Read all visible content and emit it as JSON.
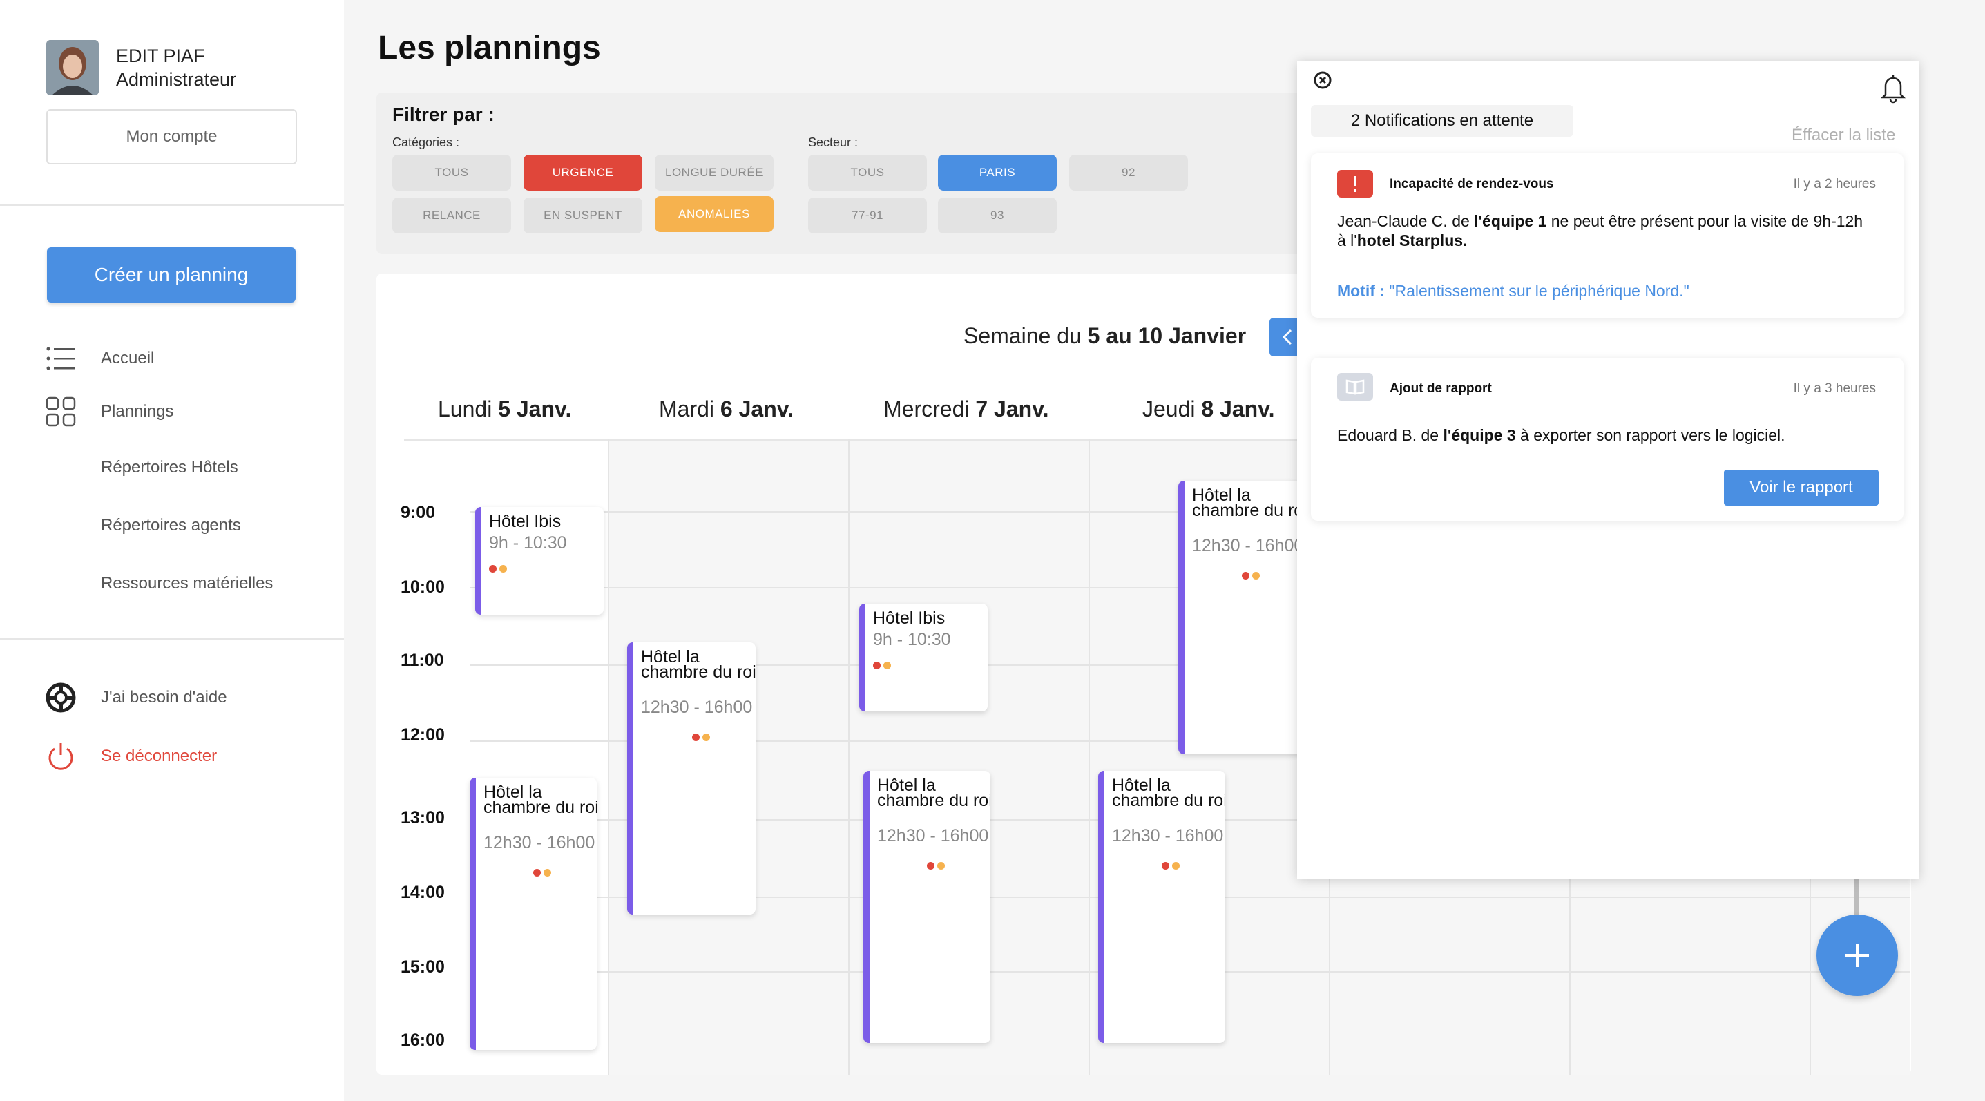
{
  "user": {
    "name": "EDIT PIAF",
    "role": "Administrateur",
    "account_label": "Mon compte"
  },
  "sidebar": {
    "create_label": "Créer un planning",
    "items": [
      {
        "label": "Accueil",
        "icon": "list-icon"
      },
      {
        "label": "Plannings",
        "icon": "grid-icon"
      },
      {
        "label": "Répertoires Hôtels"
      },
      {
        "label": "Répertoires agents"
      },
      {
        "label": "Ressources matérielles"
      }
    ],
    "help_label": "J'ai besoin d'aide",
    "logout_label": "Se déconnecter"
  },
  "page": {
    "title": "Les plannings"
  },
  "filters": {
    "title": "Filtrer par :",
    "categories_label": "Catégories :",
    "sector_label": "Secteur :",
    "categories": [
      "TOUS",
      "URGENCE",
      "LONGUE DURÉE",
      "RELANCE",
      "EN SUSPENT",
      "ANOMALIES"
    ],
    "sectors": [
      "TOUS",
      "PARIS",
      "92",
      "77-91",
      "93"
    ]
  },
  "calendar": {
    "week_prefix": "Semaine du ",
    "week_range": "5 au 10 Janvier",
    "days": [
      {
        "name": "Lundi ",
        "date": "5 Janv."
      },
      {
        "name": "Mardi ",
        "date": "6 Janv."
      },
      {
        "name": "Mercredi ",
        "date": "7 Janv."
      },
      {
        "name": "Jeudi ",
        "date": "8 Janv."
      }
    ],
    "hours": [
      "9:00",
      "10:00",
      "11:00",
      "12:00",
      "13:00",
      "14:00",
      "15:00",
      "16:00"
    ],
    "events": [
      {
        "title": "Hôtel Ibis",
        "time": "9h - 10:30"
      },
      {
        "title": "Hôtel la chambre du roi",
        "time": "12h30 - 16h00"
      },
      {
        "title": "Hôtel la chambre du roi",
        "time": "12h30 - 16h00"
      },
      {
        "title": "Hôtel Ibis",
        "time": "9h - 10:30"
      },
      {
        "title": "Hôtel la chambre du roi",
        "time": "12h30 - 16h00"
      },
      {
        "title": "Hôtel la chambre du roi",
        "time": "12h30 - 16h00"
      },
      {
        "title": "Hôtel la chambre du roi",
        "time": "12h30 - 16h00"
      }
    ]
  },
  "notifications": {
    "count_label": "2 Notifications en attente",
    "clear_label": "Éffacer la liste",
    "items": [
      {
        "type": "Incapacité de rendez-vous",
        "time": "Il y a 2 heures",
        "body_1": "Jean-Claude C. de ",
        "body_team": "l'équipe 1",
        "body_2": " ne peut être présent pour la visite de 9h-12h à l'",
        "body_hotel": "hotel Starplus.",
        "motif_label": "Motif : ",
        "motif_value": "\"Ralentissement sur le périphérique Nord.\""
      },
      {
        "type": "Ajout de rapport",
        "time": "Il y a 3 heures",
        "body_1": "Edouard B. de ",
        "body_team": "l'équipe 3",
        "body_2": " à exporter son rapport vers le logiciel.",
        "action_label": "Voir le rapport"
      }
    ]
  },
  "colors": {
    "accent": "#4a8fe2",
    "urgent": "#e0463a",
    "warning": "#f6b24e",
    "event_bar": "#7b5ce8"
  }
}
